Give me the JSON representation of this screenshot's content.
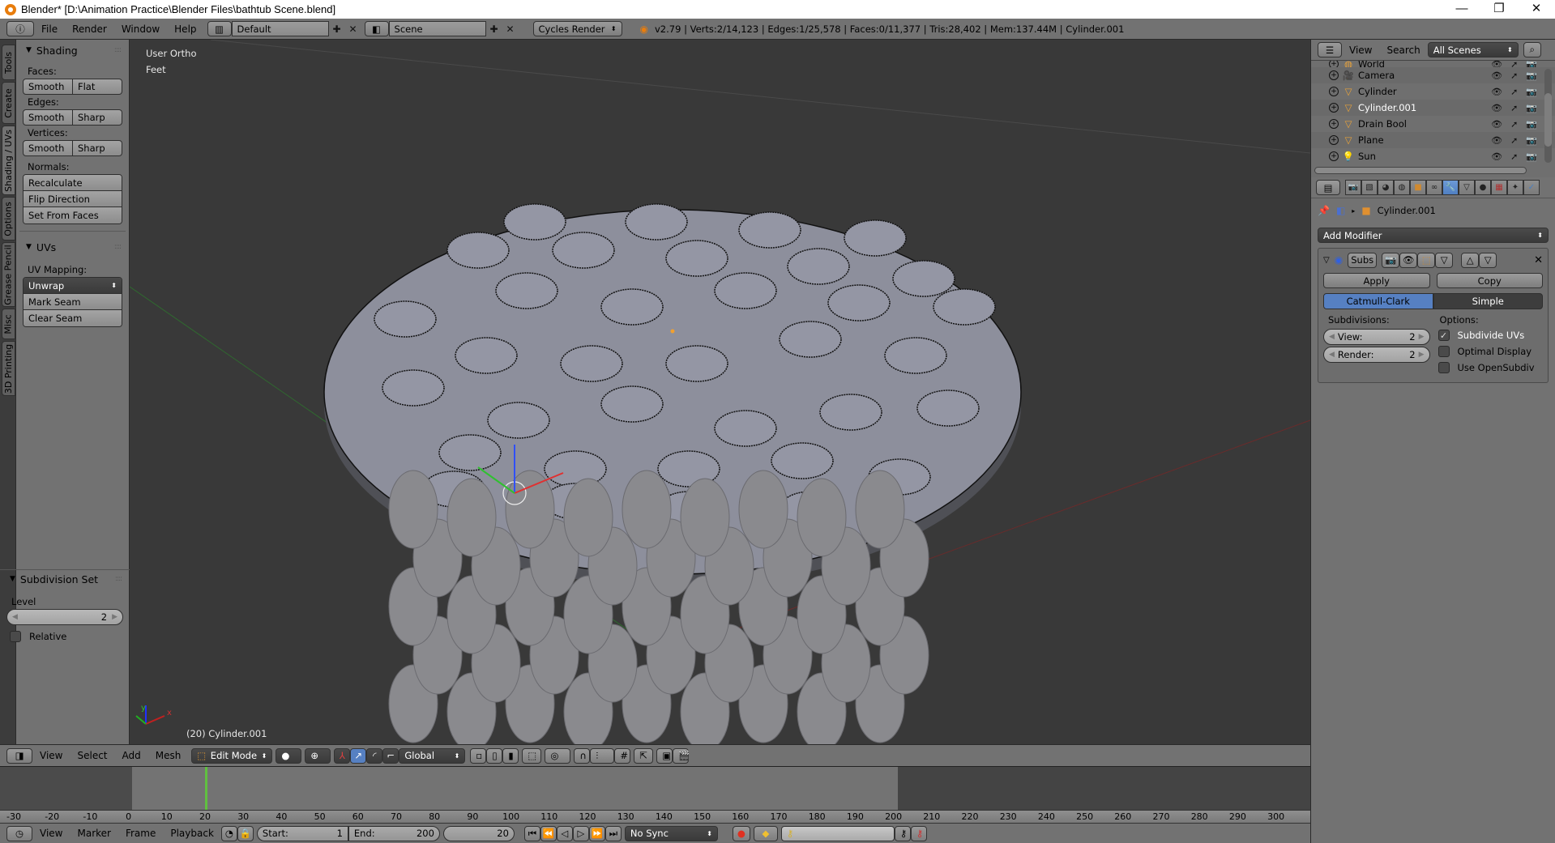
{
  "window": {
    "title": "Blender* [D:\\Animation Practice\\Blender Files\\bathtub Scene.blend]",
    "controls": {
      "minimize": "—",
      "restore": "❐",
      "close": "✕"
    }
  },
  "info_header": {
    "menus": [
      "File",
      "Render",
      "Window",
      "Help"
    ],
    "layout": "Default",
    "scene": "Scene",
    "render_engine": "Cycles Render",
    "stats": "v2.79 | Verts:2/14,123 | Edges:1/25,578 | Faces:0/11,377 | Tris:28,402 | Mem:137.44M | Cylinder.001"
  },
  "tool_tabs": [
    "Tools",
    "Create",
    "Shading / UVs",
    "Options",
    "Grease Pencil",
    "Misc",
    "3D Printing"
  ],
  "active_tool_tab": "Shading / UVs",
  "toolshelf": {
    "shading": {
      "title": "Shading",
      "faces_label": "Faces:",
      "faces": [
        "Smooth",
        "Flat"
      ],
      "edges_label": "Edges:",
      "edges": [
        "Smooth",
        "Sharp"
      ],
      "vertices_label": "Vertices:",
      "vertices": [
        "Smooth",
        "Sharp"
      ],
      "normals_label": "Normals:",
      "normals": [
        "Recalculate",
        "Flip Direction",
        "Set From Faces"
      ]
    },
    "uvs": {
      "title": "UVs",
      "mapping_label": "UV Mapping:",
      "unwrap": "Unwrap",
      "mark_seam": "Mark Seam",
      "clear_seam": "Clear Seam"
    },
    "subdivision_set": {
      "title": "Subdivision Set",
      "level_label": "Level",
      "level_value": "2",
      "relative_label": "Relative",
      "relative_checked": false
    }
  },
  "viewport": {
    "view_name": "User Ortho",
    "units": "Feet",
    "object_label": "(20) Cylinder.001",
    "axes": {
      "x": "x",
      "y": "y",
      "z": "z"
    }
  },
  "view3d_header": {
    "menus": [
      "View",
      "Select",
      "Add",
      "Mesh"
    ],
    "mode": "Edit Mode",
    "orientation": "Global"
  },
  "timeline": {
    "ruler_ticks": [
      "-30",
      "-20",
      "-10",
      "0",
      "10",
      "20",
      "30",
      "40",
      "50",
      "60",
      "70",
      "80",
      "90",
      "100",
      "110",
      "120",
      "130",
      "140",
      "150",
      "160",
      "170",
      "180",
      "190",
      "200",
      "210",
      "220",
      "230",
      "240",
      "250",
      "260",
      "270",
      "280",
      "290",
      "300"
    ],
    "menus": [
      "View",
      "Marker",
      "Frame",
      "Playback"
    ],
    "start_label": "Start:",
    "start": "1",
    "end_label": "End:",
    "end": "200",
    "current_frame": "20",
    "sync": "No Sync"
  },
  "outliner": {
    "menus": [
      "View",
      "Search"
    ],
    "filter": "All Scenes",
    "items": [
      {
        "name": "World",
        "icon": "world-icon",
        "selected": false
      },
      {
        "name": "Camera",
        "icon": "camera-icon",
        "selected": false
      },
      {
        "name": "Cylinder",
        "icon": "mesh-icon",
        "selected": false
      },
      {
        "name": "Cylinder.001",
        "icon": "mesh-icon",
        "selected": true
      },
      {
        "name": "Drain Bool",
        "icon": "mesh-icon",
        "selected": false
      },
      {
        "name": "Plane",
        "icon": "mesh-icon",
        "selected": false
      },
      {
        "name": "Sun",
        "icon": "lamp-icon",
        "selected": false
      }
    ]
  },
  "properties": {
    "context_object": "Cylinder.001",
    "add_modifier": "Add Modifier",
    "modifier": {
      "name": "Subs",
      "apply": "Apply",
      "copy": "Copy",
      "algorithms": [
        "Catmull-Clark",
        "Simple"
      ],
      "active_algorithm": "Catmull-Clark",
      "subdivisions_label": "Subdivisions:",
      "view_label": "View:",
      "view_value": "2",
      "render_label": "Render:",
      "render_value": "2",
      "options_label": "Options:",
      "options": [
        {
          "label": "Subdivide UVs",
          "checked": true
        },
        {
          "label": "Optimal Display",
          "checked": false
        },
        {
          "label": "Use OpenSubdiv",
          "checked": false
        }
      ]
    }
  },
  "colors": {
    "accent_blue": "#5680c2",
    "panel_gray": "#727272",
    "viewport_bg": "#393939",
    "mesh_face": "#8d8f9c"
  }
}
